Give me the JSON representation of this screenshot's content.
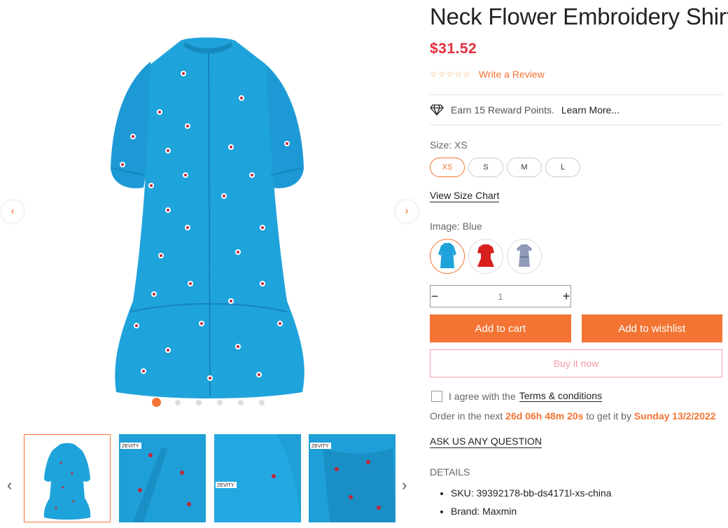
{
  "product": {
    "title": "Neck Flower Embroidery Shirt",
    "price": "$31.52",
    "write_review": "Write a Review",
    "reward_text": "Earn 15 Reward Points.",
    "learn_more": "Learn More...",
    "size_label": "Size: XS",
    "sizes": [
      "XS",
      "S",
      "M",
      "L"
    ],
    "selected_size": "XS",
    "size_chart": "View Size Chart",
    "image_label": "Image: Blue",
    "swatches": [
      "blue-dress",
      "red-dress",
      "gray-dress"
    ],
    "quantity": "1",
    "add_to_cart": "Add to cart",
    "add_to_wishlist": "Add to wishlist",
    "buy_now": "Buy it now",
    "agree_text": "I agree with the",
    "terms": "Terms & conditions",
    "order_prefix": "Order in the next",
    "order_countdown": "26d 06h 48m 20s",
    "order_middle": "to get it by",
    "order_date": "Sunday 13/2/2022",
    "ask": "ASK US ANY QUESTION",
    "details_label": "DETAILS",
    "details": [
      "SKU: 39392178-bb-ds4171l-xs-china",
      "Brand: Maxmin"
    ]
  },
  "gallery": {
    "dot_count": 6,
    "active_dot": 0,
    "thumb_tag": "ZEVITY"
  },
  "colors": {
    "accent": "#f37433",
    "price": "#e0303f",
    "dress": "#1e9fd8"
  }
}
